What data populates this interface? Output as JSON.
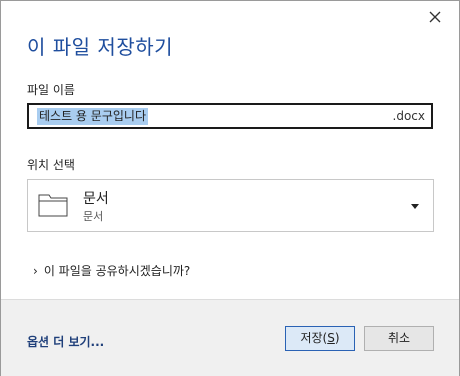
{
  "dialog": {
    "title": "이 파일 저장하기",
    "close_icon": "close-icon"
  },
  "filename": {
    "label": "파일 이름",
    "value": "테스트 용 문구입니다",
    "extension": ".docx"
  },
  "location": {
    "label": "위치 선택",
    "name": "문서",
    "subtitle": "문서",
    "icon": "folder-icon"
  },
  "share": {
    "label": "이 파일을 공유하시겠습니까?"
  },
  "footer": {
    "more_options": "옵션 더 보기...",
    "save_prefix": "저장(",
    "save_mnemonic": "S",
    "save_suffix": ")",
    "cancel_label": "취소"
  }
}
